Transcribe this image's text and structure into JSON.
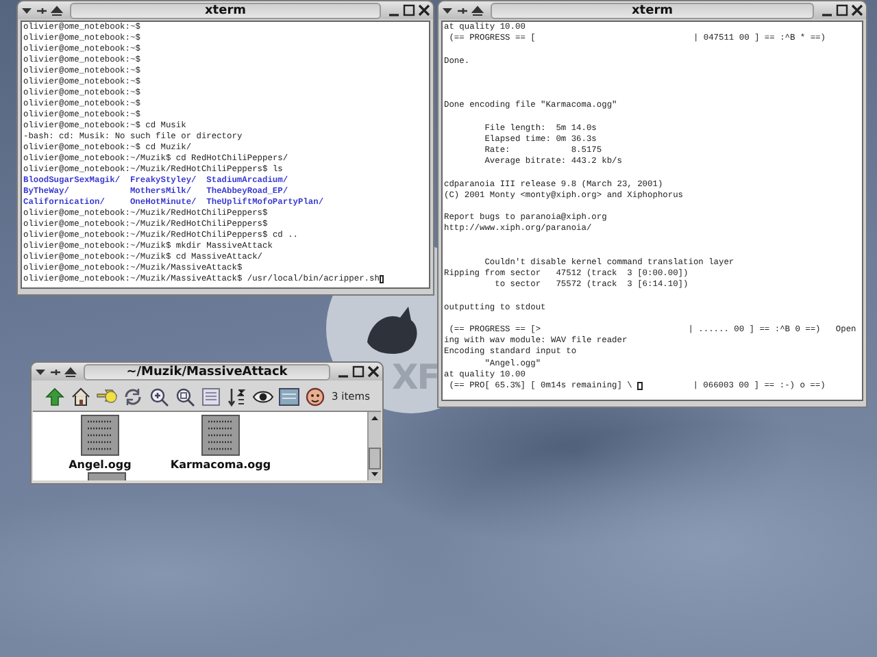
{
  "desktop": {
    "logo_text": "XF"
  },
  "windows": [
    {
      "kind": "terminal",
      "title": "xterm",
      "lines": [
        {
          "kind": "text",
          "text": "olivier@ome_notebook:~$"
        },
        {
          "kind": "text",
          "text": "olivier@ome_notebook:~$"
        },
        {
          "kind": "text",
          "text": "olivier@ome_notebook:~$"
        },
        {
          "kind": "text",
          "text": "olivier@ome_notebook:~$"
        },
        {
          "kind": "text",
          "text": "olivier@ome_notebook:~$"
        },
        {
          "kind": "text",
          "text": "olivier@ome_notebook:~$"
        },
        {
          "kind": "text",
          "text": "olivier@ome_notebook:~$"
        },
        {
          "kind": "text",
          "text": "olivier@ome_notebook:~$"
        },
        {
          "kind": "text",
          "text": "olivier@ome_notebook:~$"
        },
        {
          "kind": "text",
          "text": "olivier@ome_notebook:~$ cd Musik"
        },
        {
          "kind": "text",
          "text": "-bash: cd: Musik: No such file or directory"
        },
        {
          "kind": "text",
          "text": "olivier@ome_notebook:~$ cd Muzik/"
        },
        {
          "kind": "text",
          "text": "olivier@ome_notebook:~/Muzik$ cd RedHotChiliPeppers/"
        },
        {
          "kind": "text",
          "text": "olivier@ome_notebook:~/Muzik/RedHotChiliPeppers$ ls"
        },
        {
          "kind": "dirs",
          "entries": [
            "BloodSugarSexMagik/",
            "FreakyStyley/",
            "StadiumArcadium/"
          ]
        },
        {
          "kind": "dirs",
          "entries": [
            "ByTheWay/",
            "MothersMilk/",
            "TheAbbeyRoad_EP/"
          ]
        },
        {
          "kind": "dirs",
          "entries": [
            "Californication/",
            "OneHotMinute/",
            "TheUpliftMofoPartyPlan/"
          ]
        },
        {
          "kind": "text",
          "text": "olivier@ome_notebook:~/Muzik/RedHotChiliPeppers$"
        },
        {
          "kind": "text",
          "text": "olivier@ome_notebook:~/Muzik/RedHotChiliPeppers$"
        },
        {
          "kind": "text",
          "text": "olivier@ome_notebook:~/Muzik/RedHotChiliPeppers$ cd .."
        },
        {
          "kind": "text",
          "text": "olivier@ome_notebook:~/Muzik$ mkdir MassiveAttack"
        },
        {
          "kind": "text",
          "text": "olivier@ome_notebook:~/Muzik$ cd MassiveAttack/"
        },
        {
          "kind": "text",
          "text": "olivier@ome_notebook:~/Muzik/MassiveAttack$"
        },
        {
          "kind": "cursor",
          "text": "olivier@ome_notebook:~/Muzik/MassiveAttack$ /usr/local/bin/acripper.sh"
        }
      ]
    },
    {
      "kind": "terminal",
      "title": "xterm",
      "lines": [
        {
          "kind": "text",
          "text": "at quality 10.00"
        },
        {
          "kind": "text",
          "text": " (== PROGRESS == [                               | 047511 00 ] == :^B * ==)"
        },
        {
          "kind": "blank"
        },
        {
          "kind": "text",
          "text": "Done."
        },
        {
          "kind": "blank"
        },
        {
          "kind": "blank"
        },
        {
          "kind": "blank"
        },
        {
          "kind": "text",
          "text": "Done encoding file \"Karmacoma.ogg\""
        },
        {
          "kind": "blank"
        },
        {
          "kind": "text",
          "text": "        File length:  5m 14.0s"
        },
        {
          "kind": "text",
          "text": "        Elapsed time: 0m 36.3s"
        },
        {
          "kind": "text",
          "text": "        Rate:            8.5175"
        },
        {
          "kind": "text",
          "text": "        Average bitrate: 443.2 kb/s"
        },
        {
          "kind": "blank"
        },
        {
          "kind": "text",
          "text": "cdparanoia III release 9.8 (March 23, 2001)"
        },
        {
          "kind": "text",
          "text": "(C) 2001 Monty <monty@xiph.org> and Xiphophorus"
        },
        {
          "kind": "blank"
        },
        {
          "kind": "text",
          "text": "Report bugs to paranoia@xiph.org"
        },
        {
          "kind": "text",
          "text": "http://www.xiph.org/paranoia/"
        },
        {
          "kind": "blank"
        },
        {
          "kind": "blank"
        },
        {
          "kind": "text",
          "text": "        Couldn't disable kernel command translation layer"
        },
        {
          "kind": "text",
          "text": "Ripping from sector   47512 (track  3 [0:00.00])"
        },
        {
          "kind": "text",
          "text": "          to sector   75572 (track  3 [6:14.10])"
        },
        {
          "kind": "blank"
        },
        {
          "kind": "text",
          "text": "outputting to stdout"
        },
        {
          "kind": "blank"
        },
        {
          "kind": "text",
          "text": " (== PROGRESS == [>                             | ...... 00 ] == :^B 0 ==)   Open"
        },
        {
          "kind": "text",
          "text": "ing with wav module: WAV file reader"
        },
        {
          "kind": "text",
          "text": "Encoding standard input to"
        },
        {
          "kind": "text",
          "text": "        \"Angel.ogg\""
        },
        {
          "kind": "text",
          "text": "at quality 10.00"
        },
        {
          "kind": "cursor",
          "text": " (== PRO[ 65.3%] [ 0m14s remaining] \\ ",
          "after": "          | 066003 00 ] == :-) o ==)"
        }
      ]
    },
    {
      "kind": "filemanager",
      "title": "~/Muzik/MassiveAttack",
      "item_count": "3 items",
      "files": [
        {
          "name": "Angel.ogg"
        },
        {
          "name": "Karmacoma.ogg"
        }
      ]
    }
  ]
}
